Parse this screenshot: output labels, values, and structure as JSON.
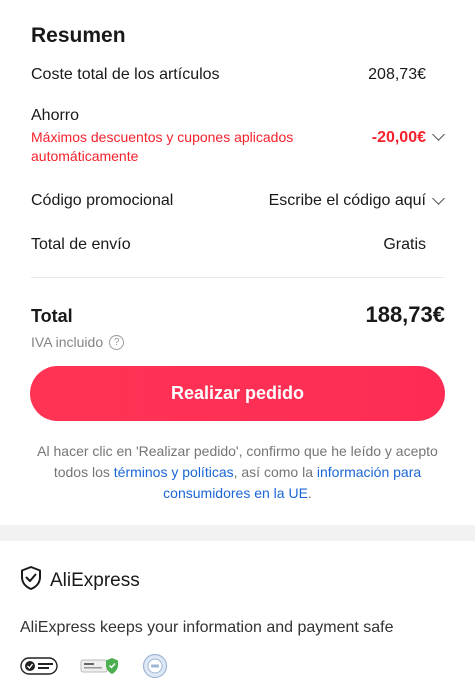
{
  "summary": {
    "title": "Resumen",
    "items_cost_label": "Coste total de los artículos",
    "items_cost_value": "208,73€",
    "savings_label": "Ahorro",
    "savings_note": "Máximos descuentos y cupones aplicados automáticamente",
    "savings_value": "-20,00€",
    "promo_label": "Código promocional",
    "promo_placeholder": "Escribe el código aquí",
    "shipping_label": "Total de envío",
    "shipping_value": "Gratis",
    "total_label": "Total",
    "total_value": "188,73€",
    "tax_note": "IVA incluido",
    "help_glyph": "?",
    "order_button": "Realizar pedido",
    "terms_part1": "Al hacer clic en 'Realizar pedido', confirmo que he leído y acepto todos los ",
    "terms_link1": "términos y políticas",
    "terms_part2": ", así como la ",
    "terms_link2": "información para consumidores en la UE",
    "terms_part3": "."
  },
  "footer": {
    "brand_name": "AliExpress",
    "safe_text": "AliExpress keeps your information and payment safe",
    "badges": [
      "visa-secure-icon",
      "ssl-secure-icon",
      "iso-certified-icon"
    ]
  },
  "colors": {
    "accent_red": "#f5222d",
    "button": "#fe2c55",
    "link": "#1a66d6"
  }
}
